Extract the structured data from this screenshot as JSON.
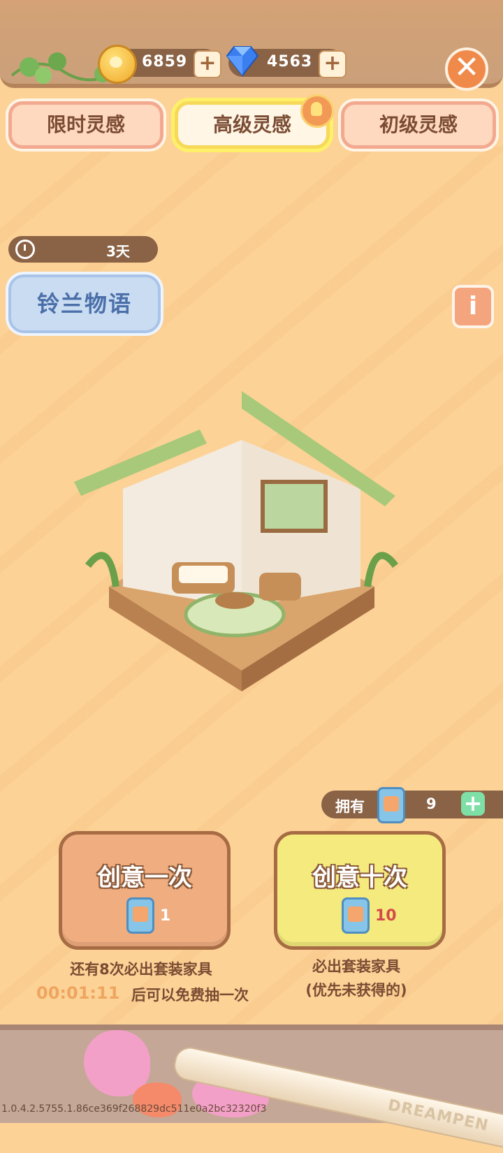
{
  "currency": {
    "coins": "6859",
    "gems": "4563"
  },
  "tabs": [
    {
      "label": "限时灵感"
    },
    {
      "label": "高级灵感"
    },
    {
      "label": "初级灵感"
    }
  ],
  "timer": {
    "remaining": "3天"
  },
  "set_name": "铃兰物语",
  "owned": {
    "label": "拥有",
    "count": "9"
  },
  "draw_one": {
    "label": "创意一次",
    "cost": "1"
  },
  "draw_ten": {
    "label": "创意十次",
    "cost": "10"
  },
  "notes": {
    "one_line1": "还有8次必出套装家具",
    "countdown": "00:01:11",
    "one_line2": "后可以免费抽一次",
    "ten_line1": "必出套装家具",
    "ten_line2": "(优先未获得的)"
  },
  "pen_brand": "DREAMPEN",
  "version": "1.0.4.2.5755.1.86ce369f268829dc511e0a2bc32320f3",
  "colors": {
    "background": "#fcd296",
    "accent": "#f08a4b",
    "gem": "#3a7ef0"
  }
}
